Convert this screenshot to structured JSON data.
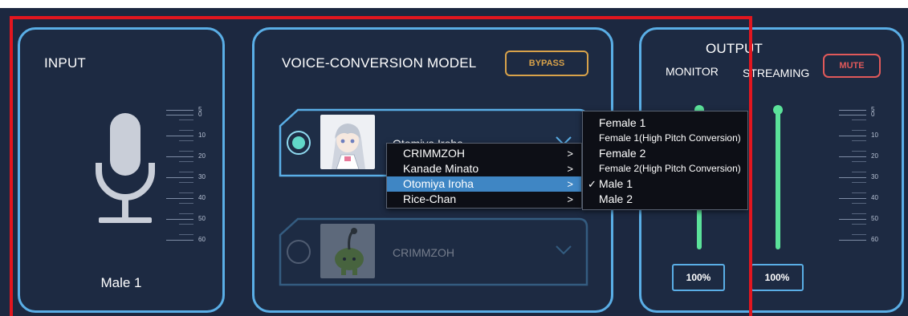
{
  "input": {
    "title": "INPUT",
    "voice": "Male 1",
    "mic_icon": "microphone-icon",
    "scale_labels": [
      "5",
      "0",
      "10",
      "20",
      "30",
      "40",
      "50",
      "60"
    ]
  },
  "model": {
    "title": "VOICE-CONVERSION MODEL",
    "bypass_label": "BYPASS",
    "slots": [
      {
        "name": "Otomiya Iroha",
        "selected": true,
        "avatar_icon": "character-avatar-icon"
      },
      {
        "name": "CRIMMZOH",
        "selected": false,
        "avatar_icon": "character-avatar-icon"
      }
    ],
    "model_menu": {
      "items": [
        {
          "label": "CRIMMZOH",
          "arrow": ">"
        },
        {
          "label": "Kanade Minato",
          "arrow": ">"
        },
        {
          "label": "Otomiya Iroha",
          "arrow": ">",
          "highlighted": true
        },
        {
          "label": "Rice-Chan",
          "arrow": ">"
        }
      ]
    },
    "voice_menu": {
      "items": [
        {
          "label": "Female 1"
        },
        {
          "label": "Female 1(High Pitch Conversion)"
        },
        {
          "label": "Female 2"
        },
        {
          "label": "Female 2(High Pitch Conversion)"
        },
        {
          "label": "Male 1",
          "checked": true,
          "check": "✓"
        },
        {
          "label": "Male 2"
        }
      ]
    }
  },
  "output": {
    "title": "OUTPUT",
    "mute_label": "MUTE",
    "monitor_label": "MONITOR",
    "streaming_label": "STREAMING",
    "monitor_level": "100%",
    "streaming_level": "100%",
    "monitor_level_fraction": 1.0,
    "streaming_level_fraction": 1.0,
    "scale_labels": [
      "5",
      "0",
      "10",
      "20",
      "30",
      "40",
      "50",
      "60"
    ]
  },
  "colors": {
    "background": "#1c2840",
    "panel_border": "#5aaee6",
    "bypass": "#d8a24a",
    "mute": "#e0595a",
    "slider": "#5be29a",
    "menu_highlight": "#3f86c4",
    "annotation": "#e2161f"
  }
}
